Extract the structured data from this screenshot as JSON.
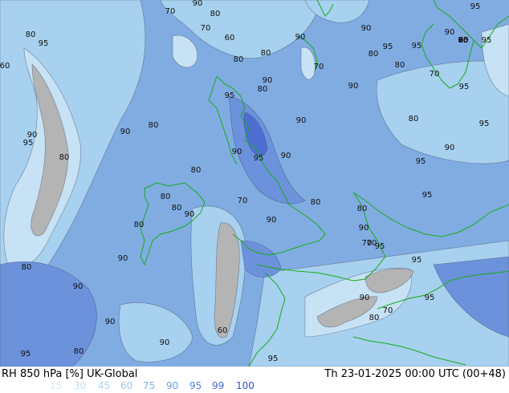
{
  "header": {
    "title": "RH 850 hPa [%] UK-Global",
    "valid_time": "Th 23-01-2025 00:00 UTC (00+48)"
  },
  "legend": [
    {
      "value": "15",
      "color": "#d8e8f8"
    },
    {
      "value": "30",
      "color": "#c4dcf2"
    },
    {
      "value": "45",
      "color": "#b0d0ec"
    },
    {
      "value": "60",
      "color": "#9cc6ec"
    },
    {
      "value": "75",
      "color": "#88b4e8"
    },
    {
      "value": "90",
      "color": "#6e9fe6"
    },
    {
      "value": "95",
      "color": "#5582de"
    },
    {
      "value": "99",
      "color": "#3f67d6"
    },
    {
      "value": "100",
      "color": "#2f50c8"
    }
  ],
  "map": {
    "colors": {
      "below_60": "#b4b4b4",
      "c60": "#c6e2f4",
      "c75": "#a7d1ee",
      "c90": "#80ace2",
      "c95": "#6c92dc",
      "c99": "#4e6fd2",
      "coastline": "#1aaa1a",
      "isoline": "#3a3a5a"
    },
    "contour_labels": [
      "70",
      "90",
      "80",
      "70",
      "60",
      "80",
      "95",
      "80",
      "60",
      "80",
      "90",
      "90",
      "95",
      "90",
      "80",
      "95",
      "70",
      "80",
      "70",
      "90",
      "90",
      "95",
      "90",
      "80",
      "95",
      "90",
      "80",
      "90",
      "80",
      "95",
      "80",
      "90",
      "95",
      "70",
      "90",
      "95",
      "95",
      "90",
      "90",
      "80",
      "80",
      "80",
      "90",
      "70",
      "80",
      "95",
      "90",
      "80",
      "80",
      "90",
      "90",
      "95",
      "90",
      "80",
      "70",
      "90",
      "95",
      "60",
      "95",
      "70",
      "95",
      "80",
      "90",
      "95",
      "60",
      "80",
      "95",
      "95",
      "80",
      "80",
      "70",
      "60",
      "95",
      "90",
      "80",
      "95",
      "80"
    ]
  }
}
